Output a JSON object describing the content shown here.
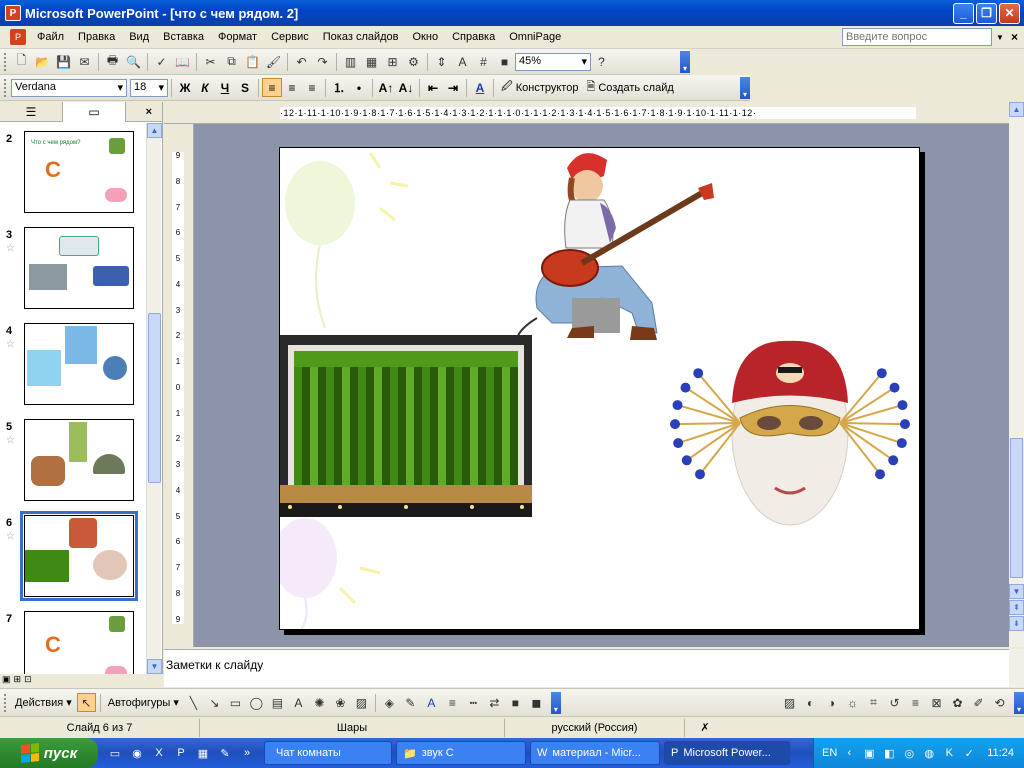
{
  "window": {
    "title": "Microsoft PowerPoint - [что с чем рядом. 2]",
    "app_icon": "powerpoint-icon"
  },
  "menu": {
    "items": [
      "Файл",
      "Правка",
      "Вид",
      "Вставка",
      "Формат",
      "Сервис",
      "Показ слайдов",
      "Окно",
      "Справка",
      "OmniPage"
    ],
    "ask_placeholder": "Введите вопрос"
  },
  "toolbar_standard": {
    "zoom": "45%"
  },
  "toolbar_format": {
    "font": "Verdana",
    "size": "18",
    "bold": "Ж",
    "italic": "К",
    "underline": "Ч",
    "shadow": "S",
    "design_label": "Конструктор",
    "new_slide_label": "Создать слайд"
  },
  "ruler": {
    "horizontal": "·12·1·11·1·10·1·9·1·8·1·7·1·6·1·5·1·4·1·3·1·2·1·1·1·0·1·1·1·2·1·3·1·4·1·5·1·6·1·7·1·8·1·9·1·10·1·11·1·12·",
    "vertical": [
      "9",
      "8",
      "7",
      "6",
      "5",
      "4",
      "3",
      "2",
      "1",
      "0",
      "1",
      "2",
      "3",
      "4",
      "5",
      "6",
      "7",
      "8",
      "9"
    ]
  },
  "slides": [
    {
      "num": "2",
      "title": "Что с чем рядом?",
      "star": false
    },
    {
      "num": "3",
      "star": true
    },
    {
      "num": "4",
      "star": true
    },
    {
      "num": "5",
      "star": true
    },
    {
      "num": "6",
      "star": true,
      "selected": true
    },
    {
      "num": "7",
      "star": false
    }
  ],
  "notes": {
    "placeholder": "Заметки к слайду"
  },
  "drawing": {
    "actions_label": "Действия",
    "autoshapes_label": "Автофигуры"
  },
  "status": {
    "slide": "Слайд 6 из 7",
    "design": "Шары",
    "language": "русский (Россия)"
  },
  "taskbar": {
    "start": "пуск",
    "tasks": [
      {
        "label": "Чат комнаты",
        "icon": "chat-icon"
      },
      {
        "label": "звук С",
        "icon": "folder-icon"
      },
      {
        "label": "материал - Micr...",
        "icon": "word-icon"
      },
      {
        "label": "Microsoft Power...",
        "icon": "powerpoint-icon",
        "active": true
      }
    ],
    "lang": "EN",
    "time": "11:24"
  },
  "colors": {
    "titlebar": "#0046c7",
    "taskbar": "#245edc",
    "start": "#2f8a2f",
    "stage_green": "#4f9a1a"
  }
}
